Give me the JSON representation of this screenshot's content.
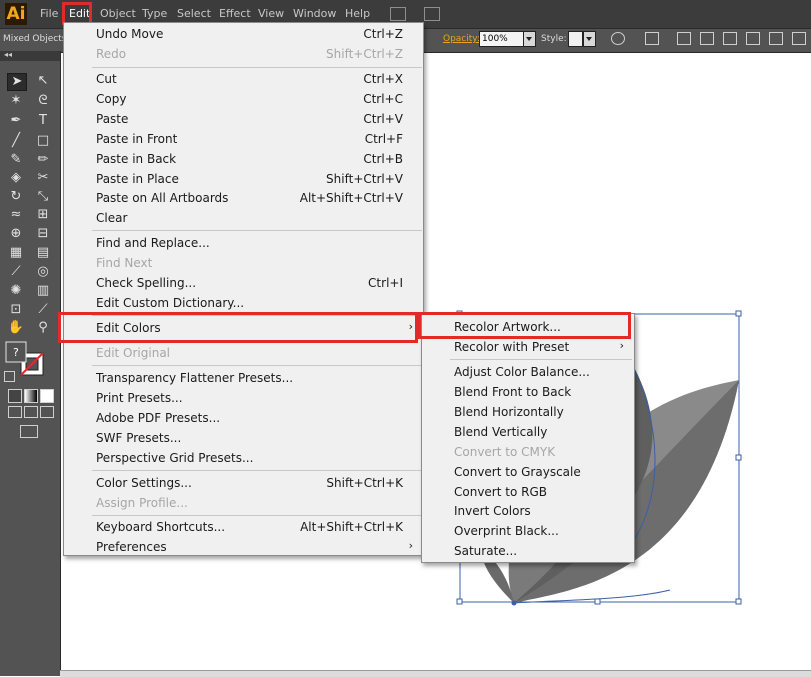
{
  "app": {
    "logo": "Ai"
  },
  "menubar": {
    "items": [
      "File",
      "Edit",
      "Object",
      "Type",
      "Select",
      "Effect",
      "View",
      "Window",
      "Help"
    ]
  },
  "controlbar": {
    "selection": "Mixed Objects",
    "opacity_label": "Opacity:",
    "opacity_value": "100%",
    "style_label": "Style:"
  },
  "fill_stroke": {
    "question": "?"
  },
  "edit_menu": {
    "items": [
      {
        "label": "Undo Move",
        "shortcut": "Ctrl+Z"
      },
      {
        "label": "Redo",
        "shortcut": "Shift+Ctrl+Z"
      },
      {
        "label": "Cut",
        "shortcut": "Ctrl+X"
      },
      {
        "label": "Copy",
        "shortcut": "Ctrl+C"
      },
      {
        "label": "Paste",
        "shortcut": "Ctrl+V"
      },
      {
        "label": "Paste in Front",
        "shortcut": "Ctrl+F"
      },
      {
        "label": "Paste in Back",
        "shortcut": "Ctrl+B"
      },
      {
        "label": "Paste in Place",
        "shortcut": "Shift+Ctrl+V"
      },
      {
        "label": "Paste on All Artboards",
        "shortcut": "Alt+Shift+Ctrl+V"
      },
      {
        "label": "Clear",
        "shortcut": ""
      },
      {
        "label": "Find and Replace...",
        "shortcut": ""
      },
      {
        "label": "Find Next",
        "shortcut": ""
      },
      {
        "label": "Check Spelling...",
        "shortcut": "Ctrl+I"
      },
      {
        "label": "Edit Custom Dictionary...",
        "shortcut": ""
      },
      {
        "label": "Edit Colors",
        "shortcut": "›"
      },
      {
        "label": "Edit Original",
        "shortcut": ""
      },
      {
        "label": "Transparency Flattener Presets...",
        "shortcut": ""
      },
      {
        "label": "Print Presets...",
        "shortcut": ""
      },
      {
        "label": "Adobe PDF Presets...",
        "shortcut": ""
      },
      {
        "label": "SWF Presets...",
        "shortcut": ""
      },
      {
        "label": "Perspective Grid Presets...",
        "shortcut": ""
      },
      {
        "label": "Color Settings...",
        "shortcut": "Shift+Ctrl+K"
      },
      {
        "label": "Assign Profile...",
        "shortcut": ""
      },
      {
        "label": "Keyboard Shortcuts...",
        "shortcut": "Alt+Shift+Ctrl+K"
      },
      {
        "label": "Preferences",
        "shortcut": "›"
      }
    ]
  },
  "edit_colors_submenu": {
    "items": [
      {
        "label": "Recolor Artwork...",
        "arrow": ""
      },
      {
        "label": "Recolor with Preset",
        "arrow": "›"
      },
      {
        "label": "Adjust Color Balance...",
        "arrow": ""
      },
      {
        "label": "Blend Front to Back",
        "arrow": ""
      },
      {
        "label": "Blend Horizontally",
        "arrow": ""
      },
      {
        "label": "Blend Vertically",
        "arrow": ""
      },
      {
        "label": "Convert to CMYK",
        "arrow": ""
      },
      {
        "label": "Convert to Grayscale",
        "arrow": ""
      },
      {
        "label": "Convert to RGB",
        "arrow": ""
      },
      {
        "label": "Invert Colors",
        "arrow": ""
      },
      {
        "label": "Overprint Black...",
        "arrow": ""
      },
      {
        "label": "Saturate...",
        "arrow": ""
      }
    ]
  },
  "colors": {
    "highlight_border": "#e12b2b",
    "logo_text": "#f3a51f"
  }
}
